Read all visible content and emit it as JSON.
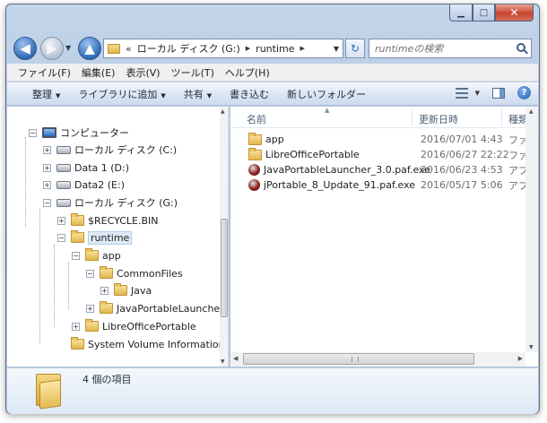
{
  "window": {
    "minimize_glyph": "▁",
    "maximize_glyph": "□",
    "close_glyph": "✕"
  },
  "navigation": {
    "back_glyph": "◀",
    "forward_glyph": "▶",
    "up_glyph": "▲",
    "history_glyph": "▼"
  },
  "address": {
    "overflow_glyph": "«",
    "crumbs": [
      "ローカル ディスク (G:)",
      "runtime"
    ],
    "separator_glyph": "▶",
    "dropdown_glyph": "▼",
    "refresh_glyph": "↻"
  },
  "search": {
    "placeholder": "runtimeの検索"
  },
  "menubar": {
    "items": [
      "ファイル(F)",
      "編集(E)",
      "表示(V)",
      "ツール(T)",
      "ヘルプ(H)"
    ]
  },
  "toolbar": {
    "organize": "整理",
    "library": "ライブラリに追加",
    "share": "共有",
    "burn": "書き込む",
    "new_folder": "新しいフォルダー",
    "caret": "▼",
    "help": "?"
  },
  "tree": {
    "computer": "コンピューター",
    "drive_c": "ローカル ディスク (C:)",
    "drive_d": "Data 1 (D:)",
    "drive_e": "Data2 (E:)",
    "drive_g": "ローカル ディスク (G:)",
    "recycle": "$RECYCLE.BIN",
    "runtime": "runtime",
    "app": "app",
    "commonfiles": "CommonFiles",
    "java": "Java",
    "jpl": "JavaPortableLauncher",
    "libre": "LibreOfficePortable",
    "svi": "System Volume Information",
    "plus": "+",
    "minus": "−"
  },
  "columns": {
    "name": "名前",
    "modified": "更新日時",
    "type": "種類",
    "sort_glyph": "▲"
  },
  "files": [
    {
      "name": "app",
      "date": "2016/07/01 4:43",
      "type": "ファイ",
      "icon": "folder-icon"
    },
    {
      "name": "LibreOfficePortable",
      "date": "2016/06/27 22:22",
      "type": "ファイ",
      "icon": "folder-icon"
    },
    {
      "name": "JavaPortableLauncher_3.0.paf.exe",
      "date": "2016/06/23 4:53",
      "type": "アプリ",
      "icon": "exe-icon"
    },
    {
      "name": "jPortable_8_Update_91.paf.exe",
      "date": "2016/05/17 5:06",
      "type": "アプリ",
      "icon": "exe-icon"
    }
  ],
  "scroll": {
    "up": "▲",
    "down": "▼",
    "left": "◀",
    "right": "▶"
  },
  "status": {
    "item_count": "4 個の項目"
  }
}
